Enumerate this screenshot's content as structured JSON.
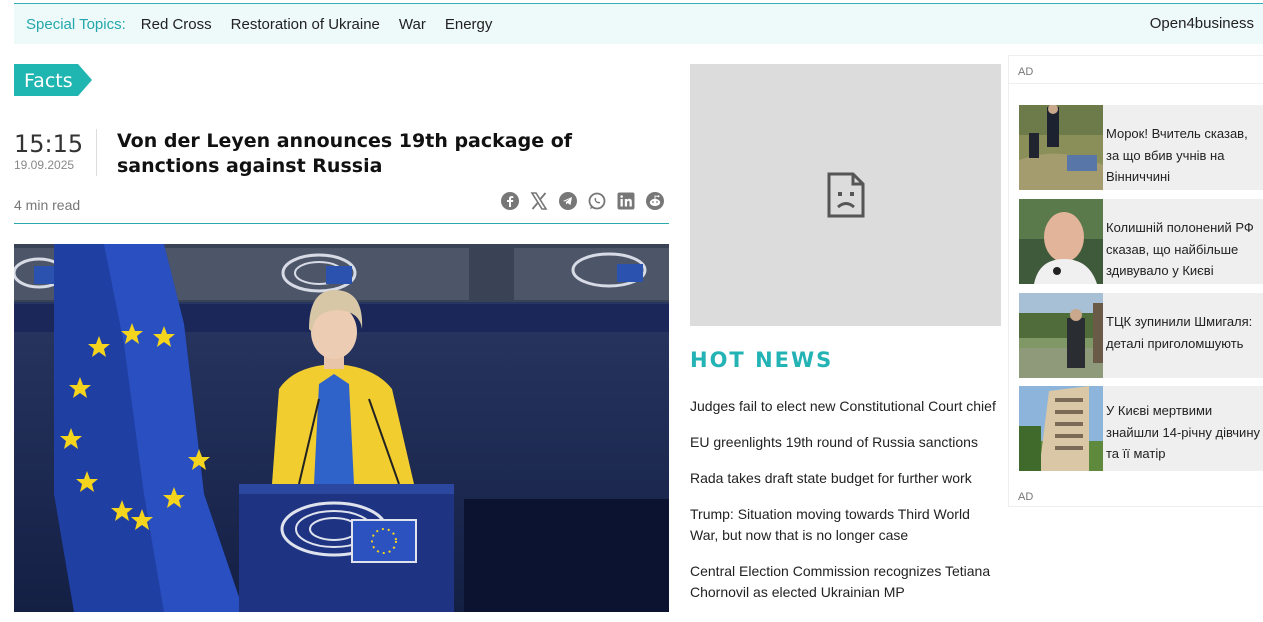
{
  "topics": {
    "label": "Special Topics:",
    "items": [
      "Red Cross",
      "Restoration of Ukraine",
      "War",
      "Energy"
    ],
    "right_link": "Open4business"
  },
  "article": {
    "tag": "Facts",
    "time": "15:15",
    "date": "19.09.2025",
    "title": "Von der Leyen announces 19th package of sanctions against Russia",
    "read_time": "4 min read",
    "share_icons": [
      "facebook-icon",
      "x-icon",
      "telegram-icon",
      "whatsapp-icon",
      "linkedin-icon",
      "reddit-icon"
    ]
  },
  "hot_news": {
    "title": "HOT NEWS",
    "items": [
      "Judges fail to elect new Constitutional Court chief",
      "EU greenlights 19th round of Russia sanctions",
      "Rada takes draft state budget for further work",
      "Trump: Situation moving towards Third World War, but now that is no longer case",
      "Central Election Commission recognizes Tetiana Chornovil as elected Ukrainian MP"
    ]
  },
  "sidebar": {
    "ad_label_top": "AD",
    "ad_label_bottom": "AD",
    "cards": [
      {
        "text": "Морок! Вчитель сказав, за що вбив учнів на Вінниччині"
      },
      {
        "text": "Колишній полонений РФ сказав, що найбільше здивувало у Києві"
      },
      {
        "text": "ТЦК зупинили Шмигаля: деталі приголомшують"
      },
      {
        "text": "У Києві мертвими знайшли 14-річну дівчину та її матір"
      }
    ]
  },
  "colors": {
    "accent": "#1fb5b1",
    "hot_news": "#24b3b5",
    "topbar_bg": "#eef9fa"
  }
}
